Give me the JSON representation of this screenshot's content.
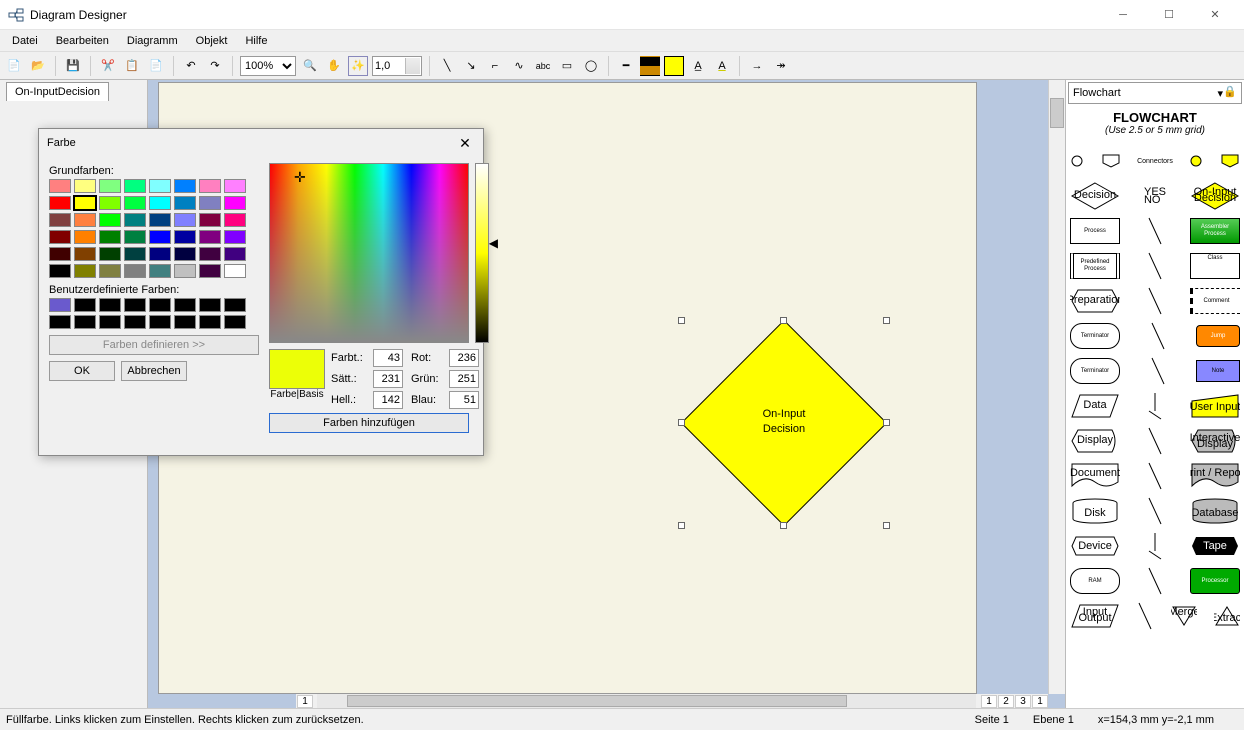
{
  "window": {
    "title": "Diagram Designer"
  },
  "menu": {
    "items": [
      "Datei",
      "Bearbeiten",
      "Diagramm",
      "Objekt",
      "Hilfe"
    ]
  },
  "toolbar": {
    "zoom": "100%",
    "spin": "1,0"
  },
  "tabs": {
    "active": "On-InputDecision"
  },
  "shape": {
    "line1": "On-Input",
    "line2": "Decision"
  },
  "scrollpages": [
    "1",
    "1",
    "2",
    "3",
    "1"
  ],
  "palette": {
    "selector": "Flowchart",
    "title": "FLOWCHART",
    "subtitle": "(Use 2.5 or 5 mm grid)",
    "row_connectors": "Connectors",
    "items": {
      "decision": "Decision",
      "yes": "YES",
      "no": "NO",
      "oninput": "On-Input Decision",
      "process": "Process",
      "assembler": "Assembler Process",
      "predef": "Predefined Process",
      "class": "Class",
      "prep": "Preparation",
      "comment": "Comment",
      "term1": "Terminator",
      "jump": "Jump",
      "term2": "Terminator",
      "note": "Note",
      "data": "Data",
      "userinput": "User Input",
      "display": "Display",
      "idisplay": "Interactive Display",
      "document": "Document",
      "print": "Print / Report",
      "disk": "Disk",
      "database": "Database",
      "device": "Device",
      "tape": "Tape",
      "ram": "RAM",
      "processor": "Processor",
      "inout": "Input Output",
      "merge": "Merge",
      "extract": "Extract"
    }
  },
  "status": {
    "hint": "Füllfarbe. Links klicken zum Einstellen. Rechts klicken zum zurücksetzen.",
    "page": "Seite 1",
    "layer": "Ebene 1",
    "coords": "x=154,3 mm  y=-2,1 mm"
  },
  "dialog": {
    "title": "Farbe",
    "basic_label": "Grundfarben:",
    "custom_label": "Benutzerdefinierte Farben:",
    "define": "Farben definieren >>",
    "ok": "OK",
    "cancel": "Abbrechen",
    "preview_label": "Farbe|Basis",
    "add": "Farben hinzufügen",
    "labels": {
      "hue": "Farbt.:",
      "sat": "Sätt.:",
      "lum": "Hell.:",
      "red": "Rot:",
      "green": "Grün:",
      "blue": "Blau:"
    },
    "vals": {
      "hue": "43",
      "sat": "231",
      "lum": "142",
      "red": "236",
      "green": "251",
      "blue": "51"
    },
    "basic_colors": [
      "#ff8080",
      "#ffff80",
      "#80ff80",
      "#00ff80",
      "#80ffff",
      "#0080ff",
      "#ff80c0",
      "#ff80ff",
      "#ff0000",
      "#ffff00",
      "#80ff00",
      "#00ff40",
      "#00ffff",
      "#0080c0",
      "#8080c0",
      "#ff00ff",
      "#804040",
      "#ff8040",
      "#00ff00",
      "#008080",
      "#004080",
      "#8080ff",
      "#800040",
      "#ff0080",
      "#800000",
      "#ff8000",
      "#008000",
      "#008040",
      "#0000ff",
      "#0000a0",
      "#800080",
      "#8000ff",
      "#400000",
      "#804000",
      "#004000",
      "#004040",
      "#000080",
      "#000040",
      "#400040",
      "#400080",
      "#000000",
      "#808000",
      "#808040",
      "#808080",
      "#408080",
      "#c0c0c0",
      "#400040",
      "#ffffff"
    ],
    "custom_colors": [
      "#6a5acd",
      "#000",
      "#000",
      "#000",
      "#000",
      "#000",
      "#000",
      "#000",
      "#000",
      "#000",
      "#000",
      "#000",
      "#000",
      "#000",
      "#000",
      "#000"
    ]
  }
}
